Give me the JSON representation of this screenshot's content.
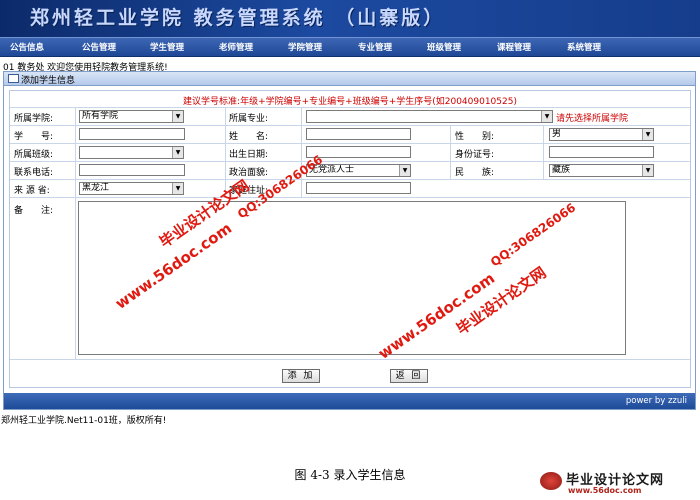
{
  "banner": {
    "title": "郑州轻工业学院 教务管理系统 （山寨版）"
  },
  "nav": {
    "items": [
      "公告信息",
      "公告管理",
      "学生管理",
      "老师管理",
      "学院管理",
      "专业管理",
      "班级管理",
      "课程管理",
      "系统管理"
    ]
  },
  "welcome": "01 教务处 欢迎您使用轻院教务管理系统!",
  "panel": {
    "title": "添加学生信息",
    "hint": "建议学号标准:年级+学院编号+专业编号+班级编号+学生序号(如200409010525)",
    "fields": {
      "college_label": "所属学院:",
      "college_value": "所有学院",
      "major_label": "所属专业:",
      "major_value": "",
      "major_hint": "请先选择所属学院",
      "student_id_label": "学　　号:",
      "name_label": "姓　　名:",
      "gender_label": "性　　别:",
      "gender_value": "男",
      "class_label": "所属班级:",
      "class_value": "",
      "birthday_label": "出生日期:",
      "id_card_label": "身份证号:",
      "phone_label": "联系电话:",
      "politics_label": "政治面貌:",
      "politics_value": "无党派人士",
      "ethnicity_label": "民　　族:",
      "ethnicity_value": "藏族",
      "origin_label": "来 源 省:",
      "origin_value": "黑龙江",
      "address_label": "家庭住址:",
      "remark_label": "备　　注:"
    },
    "buttons": {
      "add": "添 加",
      "back": "返 回"
    },
    "footer": "power by zzuli"
  },
  "copyright": "郑州轻工业学院.Net11-01班，版权所有!",
  "caption": "图 4-3  录入学生信息",
  "watermarks": {
    "site_name": "毕业设计论文网",
    "url": "www.56doc.com",
    "qq": "QQ:306826066"
  },
  "logo": {
    "name": "毕业设计论文网",
    "url": "www.56doc.com"
  },
  "colors": {
    "banner": "#1c4aa0",
    "nav": "#1e4795",
    "hint_red": "#cc0000",
    "watermark_red": "#e01a10"
  }
}
